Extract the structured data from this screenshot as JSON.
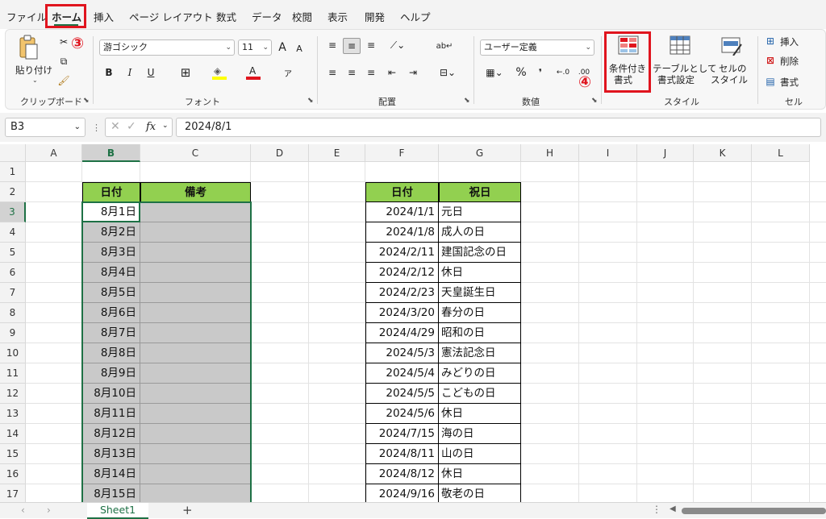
{
  "menu": {
    "tabs": [
      "ファイル",
      "ホーム",
      "挿入",
      "ページ レイアウト",
      "数式",
      "データ",
      "校閲",
      "表示",
      "開発",
      "ヘルプ"
    ],
    "active_tab": "ホーム"
  },
  "callouts": {
    "step3": "③",
    "step4": "④",
    "color": "#e0141e"
  },
  "ribbon": {
    "clipboard": {
      "paste_label": "貼り付け",
      "group_label": "クリップボード"
    },
    "font": {
      "font_name": "游ゴシック",
      "font_size": "11",
      "grow": "A",
      "shrink": "A",
      "bold": "B",
      "italic": "I",
      "underline": "U",
      "group_label": "フォント"
    },
    "alignment": {
      "group_label": "配置"
    },
    "number": {
      "format": "ユーザー定義",
      "percent": "%",
      "comma": "❜",
      "group_label": "数値"
    },
    "styles": {
      "conditional_format": "条件付き\n書式",
      "cf_line1": "条件付き",
      "cf_line2": "書式",
      "table_line1": "テーブルとして",
      "table_line2": "書式設定",
      "cell_style_line1": "セルの",
      "cell_style_line2": "スタイル",
      "group_label": "スタイル"
    },
    "cells": {
      "insert": "挿入",
      "delete": "削除",
      "format": "書式",
      "group_label": "セル"
    }
  },
  "formula_bar": {
    "name_box": "B3",
    "fx": "fx",
    "value": "2024/8/1"
  },
  "columns": [
    "A",
    "B",
    "C",
    "D",
    "E",
    "F",
    "G",
    "H",
    "I",
    "J",
    "K",
    "L"
  ],
  "rows": [
    "1",
    "2",
    "3",
    "4",
    "5",
    "6",
    "7",
    "8",
    "9",
    "10",
    "11",
    "12",
    "13",
    "14",
    "15",
    "16",
    "17"
  ],
  "table1": {
    "headers": [
      "日付",
      "備考"
    ],
    "dates": [
      "8月1日",
      "8月2日",
      "8月3日",
      "8月4日",
      "8月5日",
      "8月6日",
      "8月7日",
      "8月8日",
      "8月9日",
      "8月10日",
      "8月11日",
      "8月12日",
      "8月13日",
      "8月14日",
      "8月15日"
    ]
  },
  "table2": {
    "headers": [
      "日付",
      "祝日"
    ],
    "rows": [
      [
        "2024/1/1",
        "元日"
      ],
      [
        "2024/1/8",
        "成人の日"
      ],
      [
        "2024/2/11",
        "建国記念の日"
      ],
      [
        "2024/2/12",
        "休日"
      ],
      [
        "2024/2/23",
        "天皇誕生日"
      ],
      [
        "2024/3/20",
        "春分の日"
      ],
      [
        "2024/4/29",
        "昭和の日"
      ],
      [
        "2024/5/3",
        "憲法記念日"
      ],
      [
        "2024/5/4",
        "みどりの日"
      ],
      [
        "2024/5/5",
        "こどもの日"
      ],
      [
        "2024/5/6",
        "休日"
      ],
      [
        "2024/7/15",
        "海の日"
      ],
      [
        "2024/8/11",
        "山の日"
      ],
      [
        "2024/8/12",
        "休日"
      ],
      [
        "2024/9/16",
        "敬老の日"
      ]
    ]
  },
  "sheet": {
    "tab": "Sheet1",
    "add": "+"
  },
  "colors": {
    "header_green": "#92d050",
    "selection_gray": "#c9c9c9",
    "excel_green": "#1e7145"
  }
}
